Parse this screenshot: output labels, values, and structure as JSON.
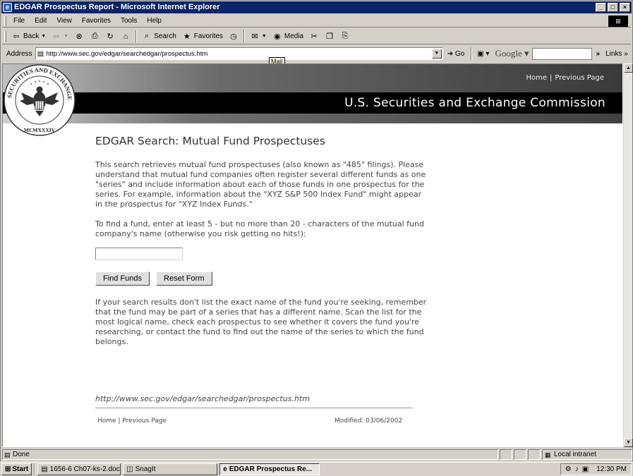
{
  "window": {
    "title": "EDGAR Prospectus Report - Microsoft Internet Explorer",
    "controls": [
      "_",
      "□",
      "×"
    ]
  },
  "menu": [
    "File",
    "Edit",
    "View",
    "Favorites",
    "Tools",
    "Help"
  ],
  "toolbar": {
    "back": "Back",
    "search": "Search",
    "favorites": "Favorites",
    "media": "Media"
  },
  "address": {
    "label": "Address",
    "url": "http://www.sec.gov/edgar/searchedgar/prospectus.htm",
    "go": "Go",
    "google": "Google",
    "links": "Links",
    "tooltip": "Mail"
  },
  "banner": {
    "home_link": "Home",
    "separator": "|",
    "previous_link": "Previous Page",
    "agency": "U.S. Securities and Exchange Commission",
    "seal_text": "SECURITIES AND EXCHANGE COMMISSION",
    "seal_year": "MCMXXXIV"
  },
  "page": {
    "heading": "EDGAR Search: Mutual Fund Prospectuses",
    "intro": "This search retrieves mutual fund prospectuses (also known as \"485\" filings). Please understand that mutual fund companies often register several different funds as one \"series\" and include information about each of those funds in one prospectus for the series. For example, information about the \"XYZ S&P 500 Index Fund\" might appear in the prospectus for \"XYZ Index Funds.\"",
    "instructions": "To find a fund, enter at least 5 - but no more than 20 - characters of the mutual fund company's name (otherwise you risk getting no hits!):",
    "search_value": "",
    "find_button": "Find Funds",
    "reset_button": "Reset Form",
    "tip": "If your search results don't list the exact name of the fund you're seeking, remember that the fund may be part of a series that has a different name. Scan the list for the most logical name, check each prospectus to see whether it covers the fund you're researching, or contact the fund to find out the name of the series to which the fund belongs.",
    "footer_url": "http://www.sec.gov/edgar/searchedgar/prospectus.htm",
    "footer_home": "Home",
    "footer_sep": "|",
    "footer_previous": "Previous Page",
    "modified": "Modified: 03/06/2002"
  },
  "status": {
    "text": "Done",
    "zone": "Local intranet"
  },
  "taskbar": {
    "start": "Start",
    "tasks": [
      "1656-6 Ch07-ks-2.doc - ...",
      "SnagIt",
      "EDGAR Prospectus Re..."
    ],
    "clock": "12:30 PM"
  }
}
